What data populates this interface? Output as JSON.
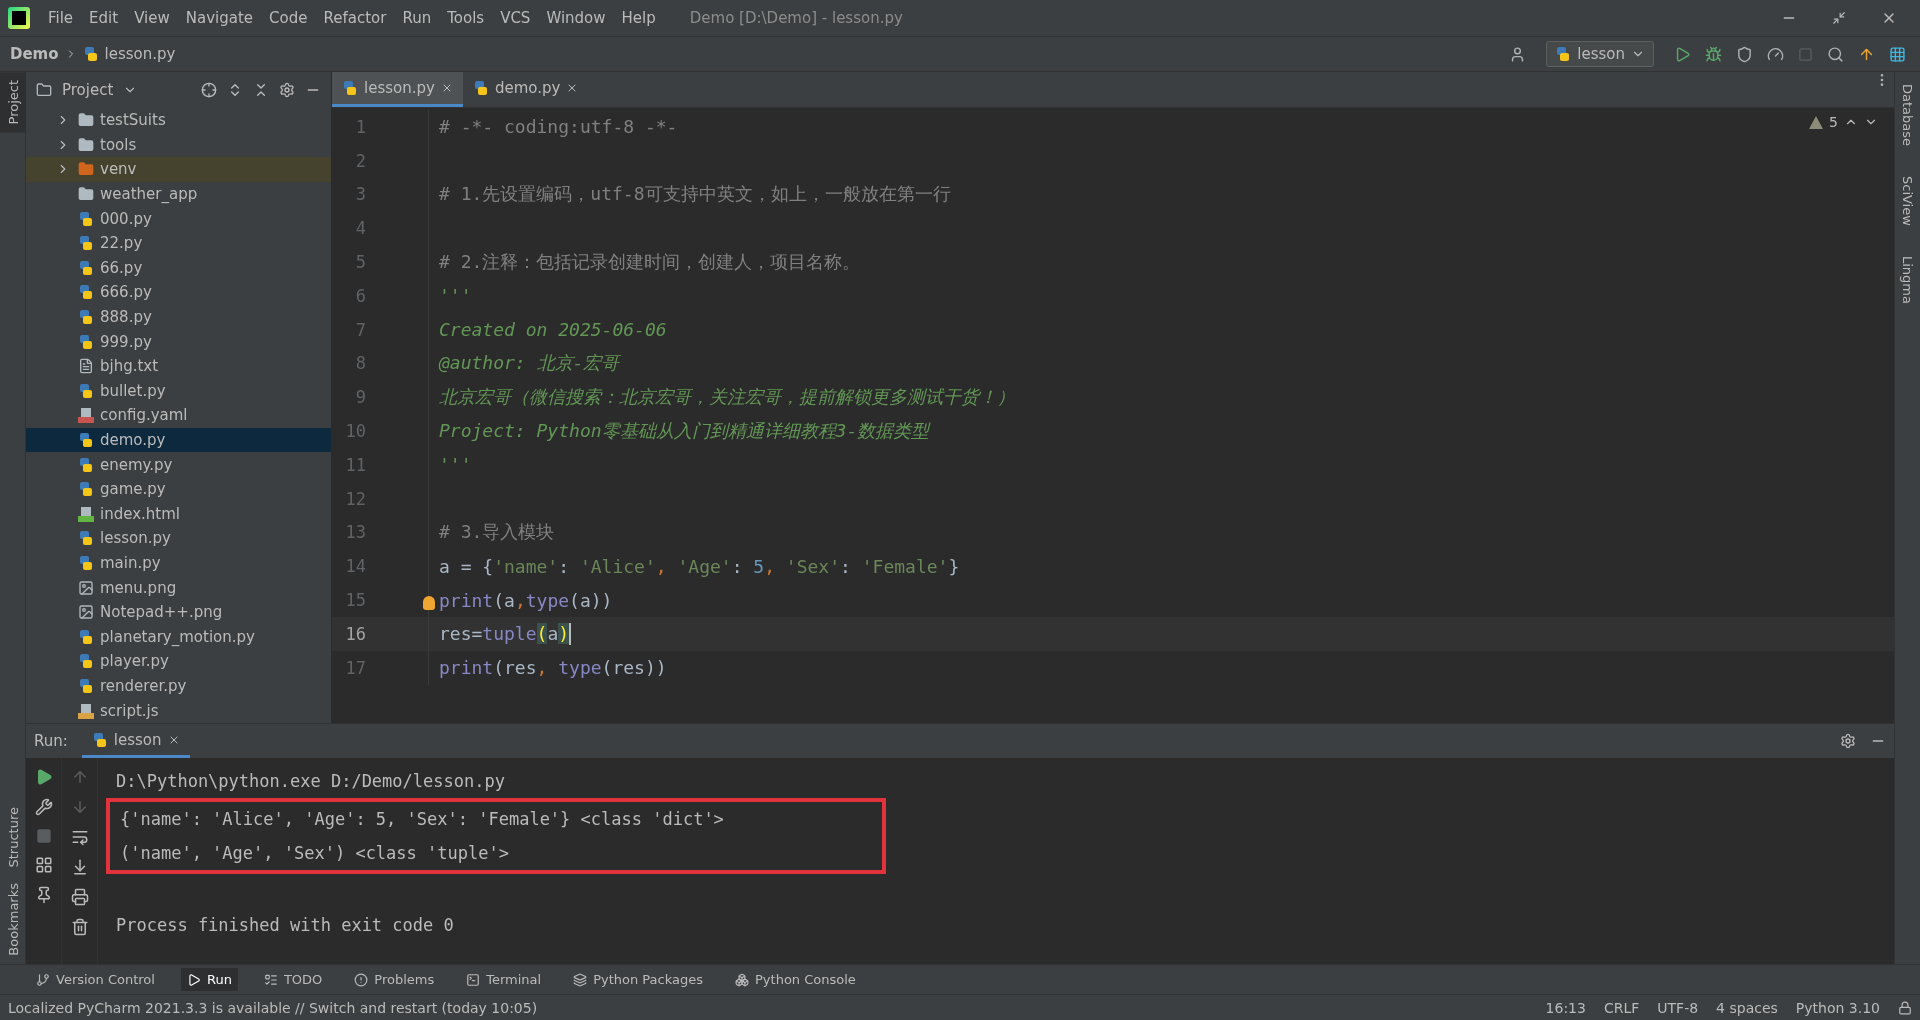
{
  "title_bar": {
    "menu": [
      "File",
      "Edit",
      "View",
      "Navigate",
      "Code",
      "Refactor",
      "Run",
      "Tools",
      "VCS",
      "Window",
      "Help"
    ],
    "title": "Demo [D:\\Demo] - lesson.py"
  },
  "nav_bar": {
    "breadcrumb": [
      "Demo",
      "lesson.py"
    ],
    "run_config": "lesson"
  },
  "left_strip": {
    "tabs": [
      {
        "label": "Project",
        "selected": true
      }
    ],
    "bottom_tabs": [
      "Structure",
      "Bookmarks"
    ]
  },
  "right_strip": {
    "tabs": [
      "Database",
      "SciView",
      "Lingma"
    ]
  },
  "project_panel": {
    "title": "Project",
    "items": [
      {
        "label": "testSuits",
        "kind": "folder",
        "expandable": true,
        "selected": false
      },
      {
        "label": "tools",
        "kind": "folder",
        "expandable": true,
        "selected": false
      },
      {
        "label": "venv",
        "kind": "excluded-folder",
        "expandable": true,
        "selected": false
      },
      {
        "label": "weather_app",
        "kind": "folder",
        "expandable": false,
        "selected": false
      },
      {
        "label": "000.py",
        "kind": "python",
        "expandable": false,
        "selected": false
      },
      {
        "label": "22.py",
        "kind": "python",
        "expandable": false,
        "selected": false
      },
      {
        "label": "66.py",
        "kind": "python",
        "expandable": false,
        "selected": false
      },
      {
        "label": "666.py",
        "kind": "python",
        "expandable": false,
        "selected": false
      },
      {
        "label": "888.py",
        "kind": "python",
        "expandable": false,
        "selected": false
      },
      {
        "label": "999.py",
        "kind": "python",
        "expandable": false,
        "selected": false
      },
      {
        "label": "bjhg.txt",
        "kind": "text",
        "expandable": false,
        "selected": false
      },
      {
        "label": "bullet.py",
        "kind": "python",
        "expandable": false,
        "selected": false
      },
      {
        "label": "config.yaml",
        "kind": "yaml",
        "expandable": false,
        "selected": false
      },
      {
        "label": "demo.py",
        "kind": "python",
        "expandable": false,
        "selected": true
      },
      {
        "label": "enemy.py",
        "kind": "python",
        "expandable": false,
        "selected": false
      },
      {
        "label": "game.py",
        "kind": "python",
        "expandable": false,
        "selected": false
      },
      {
        "label": "index.html",
        "kind": "html",
        "expandable": false,
        "selected": false
      },
      {
        "label": "lesson.py",
        "kind": "python",
        "expandable": false,
        "selected": false
      },
      {
        "label": "main.py",
        "kind": "python",
        "expandable": false,
        "selected": false
      },
      {
        "label": "menu.png",
        "kind": "image",
        "expandable": false,
        "selected": false
      },
      {
        "label": "Notepad++.png",
        "kind": "image",
        "expandable": false,
        "selected": false
      },
      {
        "label": "planetary_motion.py",
        "kind": "python",
        "expandable": false,
        "selected": false
      },
      {
        "label": "player.py",
        "kind": "python",
        "expandable": false,
        "selected": false
      },
      {
        "label": "renderer.py",
        "kind": "python",
        "expandable": false,
        "selected": false
      },
      {
        "label": "script.js",
        "kind": "js",
        "expandable": false,
        "selected": false
      }
    ]
  },
  "editor": {
    "tabs": [
      {
        "label": "lesson.py",
        "selected": true
      },
      {
        "label": "demo.py",
        "selected": false
      }
    ],
    "warnings": "5",
    "lines": [
      {
        "number": "1",
        "current": false,
        "tokens": [
          {
            "text": "# -*- coding:utf-8 -*-",
            "kind": "comment"
          }
        ]
      },
      {
        "number": "2",
        "current": false
      },
      {
        "number": "3",
        "current": false,
        "tokens": [
          {
            "text": "# 1.先设置编码，utf-8可支持中英文，如上，一般放在第一行",
            "kind": "comment"
          }
        ]
      },
      {
        "number": "4",
        "current": false
      },
      {
        "number": "5",
        "current": false,
        "tokens": [
          {
            "text": "# 2.注释：包括记录创建时间，创建人，项目名称。",
            "kind": "comment"
          }
        ]
      },
      {
        "number": "6",
        "current": false,
        "tokens": [
          {
            "text": "'''",
            "kind": "doc"
          }
        ]
      },
      {
        "number": "7",
        "current": false,
        "tokens": [
          {
            "text": "Created on 2025-06-06",
            "kind": "doc"
          }
        ]
      },
      {
        "number": "8",
        "current": false,
        "tokens": [
          {
            "text": "@author: 北京-宏哥",
            "kind": "doc"
          }
        ]
      },
      {
        "number": "9",
        "current": false,
        "tokens": [
          {
            "text": "北京宏哥（微信搜索：北京宏哥，关注宏哥，提前解锁更多测试干货！）",
            "kind": "doc"
          }
        ]
      },
      {
        "number": "10",
        "current": false,
        "tokens": [
          {
            "text": "Project: Python零基础从入门到精通详细教程3-数据类型",
            "kind": "doc"
          }
        ]
      },
      {
        "number": "11",
        "current": false,
        "tokens": [
          {
            "text": "'''",
            "kind": "doc"
          }
        ]
      },
      {
        "number": "12",
        "current": false
      },
      {
        "number": "13",
        "current": false,
        "tokens": [
          {
            "text": "# 3.导入模块",
            "kind": "comment"
          }
        ]
      },
      {
        "number": "14",
        "current": false,
        "tokens": [
          {
            "text": "a = {",
            "kind": "plain"
          },
          {
            "text": "'name'",
            "kind": "string"
          },
          {
            "text": ": ",
            "kind": "plain"
          },
          {
            "text": "'Alice'",
            "kind": "string"
          },
          {
            "text": ", ",
            "kind": "punct"
          },
          {
            "text": "'Age'",
            "kind": "string"
          },
          {
            "text": ": ",
            "kind": "plain"
          },
          {
            "text": "5",
            "kind": "number"
          },
          {
            "text": ", ",
            "kind": "punct"
          },
          {
            "text": "'Sex'",
            "kind": "string"
          },
          {
            "text": ": ",
            "kind": "plain"
          },
          {
            "text": "'Female'",
            "kind": "string"
          },
          {
            "text": "}",
            "kind": "plain"
          }
        ]
      },
      {
        "number": "15",
        "current": false,
        "bulb": true,
        "tokens": [
          {
            "text": "print",
            "kind": "builtin"
          },
          {
            "text": "(a",
            "kind": "plain"
          },
          {
            "text": ",",
            "kind": "punct"
          },
          {
            "text": "type",
            "kind": "builtin"
          },
          {
            "text": "(a))",
            "kind": "plain"
          }
        ]
      },
      {
        "number": "16",
        "current": true,
        "tokens": [
          {
            "text": "res=",
            "kind": "plain"
          },
          {
            "text": "tuple",
            "kind": "builtin"
          },
          {
            "text": "(",
            "kind": "match"
          },
          {
            "text": "a",
            "kind": "plain"
          },
          {
            "text": ")",
            "kind": "match"
          }
        ]
      },
      {
        "number": "17",
        "current": false,
        "tokens": [
          {
            "text": "print",
            "kind": "builtin"
          },
          {
            "text": "(res",
            "kind": "plain"
          },
          {
            "text": ", ",
            "kind": "punct"
          },
          {
            "text": "type",
            "kind": "builtin"
          },
          {
            "text": "(res))",
            "kind": "plain"
          }
        ]
      }
    ]
  },
  "run_panel": {
    "label": "Run:",
    "tab": "lesson",
    "output": [
      {
        "text": "D:\\Python\\python.exe D:/Demo/lesson.py",
        "kind": "command",
        "highlighted": false
      },
      {
        "text": "{'name': 'Alice', 'Age': 5, 'Sex': 'Female'} <class 'dict'>",
        "kind": "result",
        "highlighted": true
      },
      {
        "text": "('name', 'Age', 'Sex') <class 'tuple'>",
        "kind": "result",
        "highlighted": true
      },
      {
        "text": "Process finished with exit code 0",
        "kind": "info",
        "highlighted": false
      }
    ]
  },
  "tool_bar": [
    {
      "label": "Version Control",
      "kind": "vcs",
      "selected": false
    },
    {
      "label": "Run",
      "kind": "run",
      "selected": true
    },
    {
      "label": "TODO",
      "kind": "todo",
      "selected": false
    },
    {
      "label": "Problems",
      "kind": "problems",
      "selected": false
    },
    {
      "label": "Terminal",
      "kind": "terminal",
      "selected": false
    },
    {
      "label": "Python Packages",
      "kind": "packages",
      "selected": false
    },
    {
      "label": "Python Console",
      "kind": "console",
      "selected": false
    }
  ],
  "status_bar": {
    "message": "Localized PyCharm 2021.3.3 is available // Switch and restart (today 10:05)",
    "items": [
      "16:13",
      "CRLF",
      "UTF-8",
      "4 spaces",
      "Python 3.10"
    ]
  }
}
